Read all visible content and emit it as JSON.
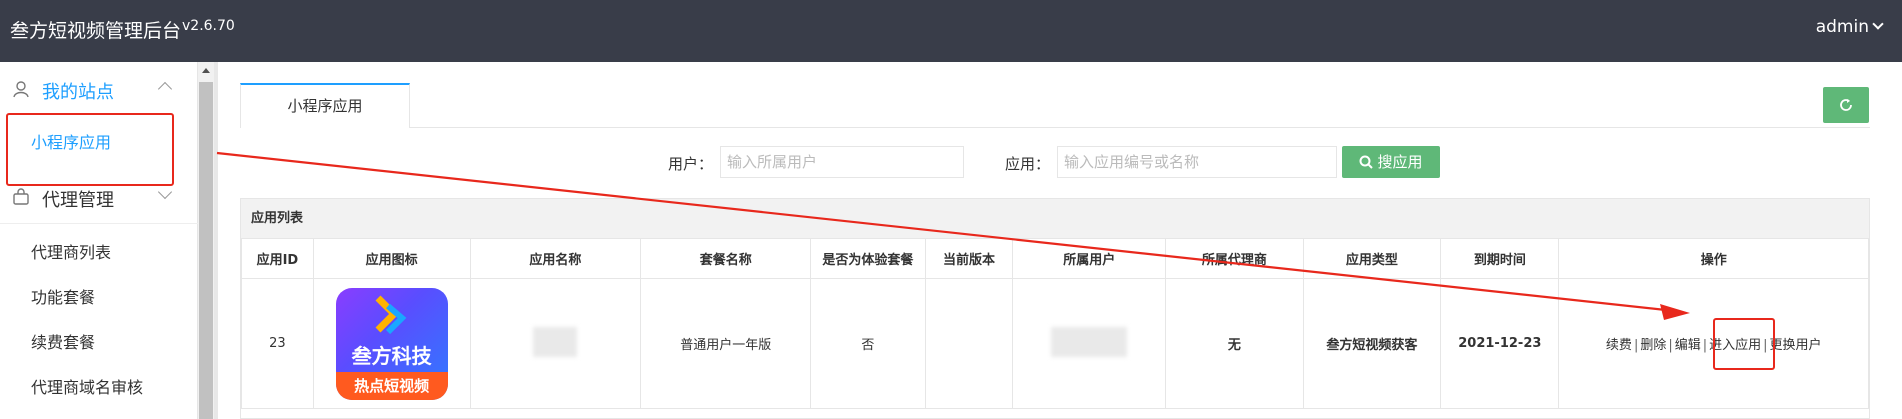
{
  "header": {
    "brand": "叁方短视频管理后台",
    "version": "v2.6.70",
    "user": "admin"
  },
  "sidebar": {
    "group1": {
      "label": "我的站点",
      "icon": "user-icon"
    },
    "active_item": "小程序应用",
    "group2": {
      "label": "代理管理",
      "icon": "bag-icon"
    },
    "items": [
      "代理商列表",
      "功能套餐",
      "续费套餐",
      "代理商域名审核"
    ]
  },
  "tab": {
    "label": "小程序应用"
  },
  "filters": {
    "user_label": "用户：",
    "user_placeholder": "输入所属用户",
    "app_label": "应用：",
    "app_placeholder": "输入应用编号或名称",
    "search_label": "搜应用"
  },
  "table": {
    "title": "应用列表",
    "columns": [
      "应用ID",
      "应用图标",
      "应用名称",
      "套餐名称",
      "是否为体验套餐",
      "当前版本",
      "所属用户",
      "所属代理商",
      "应用类型",
      "到期时间",
      "操作"
    ],
    "row": {
      "id": "23",
      "icon_text_main": "叁方科技",
      "icon_text_sub": "热点短视频",
      "package": "普通用户一年版",
      "trial": "否",
      "version": "",
      "agent": "无",
      "type": "叁方短视频获客",
      "expire": "2021-12-23",
      "ops": [
        "续费",
        "删除",
        "编辑",
        "进入应用",
        "更换用户"
      ]
    }
  },
  "colors": {
    "accent": "#1e9fff",
    "green": "#5fb878",
    "topbar": "#393d49",
    "annotation": "#e8281c"
  }
}
